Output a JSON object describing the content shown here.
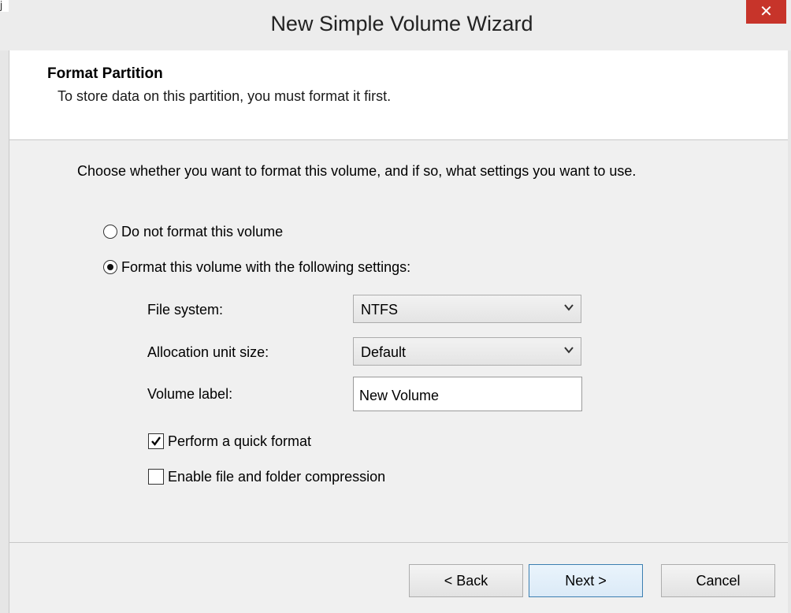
{
  "window": {
    "title": "New Simple Volume Wizard",
    "close_glyph": "✕",
    "stub_glyph": "j"
  },
  "header": {
    "title": "Format Partition",
    "subtitle": "To store data on this partition, you must format it first."
  },
  "content": {
    "instruction": "Choose whether you want to format this volume, and if so, what settings you want to use.",
    "radio_no_format": {
      "label": "Do not format this volume",
      "selected": false
    },
    "radio_format": {
      "label": "Format this volume with the following settings:",
      "selected": true
    },
    "file_system": {
      "label": "File system:",
      "value": "NTFS"
    },
    "allocation_unit": {
      "label": "Allocation unit size:",
      "value": "Default"
    },
    "volume_label": {
      "label": "Volume label:",
      "value": "New Volume"
    },
    "quick_format": {
      "label": "Perform a quick format",
      "checked": true
    },
    "compression": {
      "label": "Enable file and folder compression",
      "checked": false
    }
  },
  "footer": {
    "back_label": "< Back",
    "next_label": "Next >",
    "cancel_label": "Cancel"
  },
  "icons": {
    "dropdown": "chevron-down-icon",
    "check": "checkmark-icon",
    "close": "close-icon"
  },
  "colors": {
    "close_button": "#c7342a",
    "title_bar": "#ececec",
    "content_bg": "#f0f0f0",
    "default_button_border": "#3c7fb1"
  }
}
